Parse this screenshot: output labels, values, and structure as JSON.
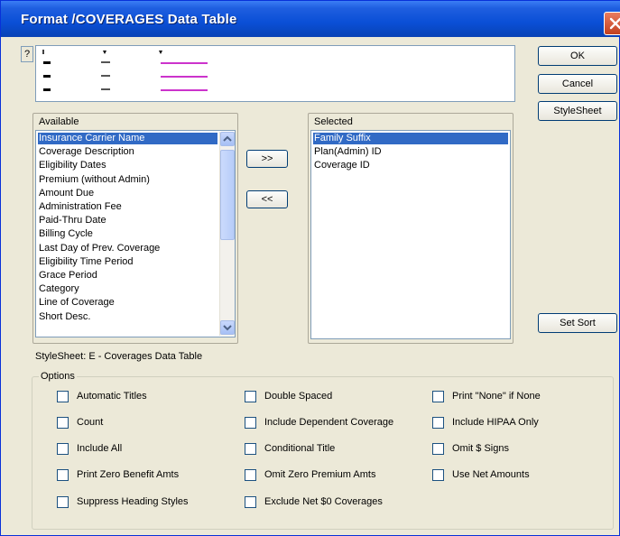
{
  "window": {
    "title": "Format  /COVERAGES  Data Table"
  },
  "buttons": {
    "help": "?",
    "ok": "OK",
    "cancel": "Cancel",
    "stylesheet": "StyleSheet",
    "add": ">>",
    "remove": "<<",
    "set_sort": "Set  Sort"
  },
  "available": {
    "label": "Available",
    "items": [
      "Insurance Carrier Name",
      "Coverage Description",
      "Eligibility Dates",
      "Premium (without Admin)",
      "Amount Due",
      "Administration Fee",
      "Paid-Thru Date",
      "Billing Cycle",
      "Last Day of Prev. Coverage",
      "Eligibility Time Period",
      "Grace Period",
      "Category",
      "Line of Coverage",
      "Short Desc."
    ],
    "selected_index": 0
  },
  "selected": {
    "label": "Selected",
    "items": [
      "Family Suffix",
      "Plan(Admin) ID",
      "Coverage ID"
    ],
    "selected_index": 0
  },
  "stylesheet_text": "StyleSheet: E - Coverages Data Table",
  "options": {
    "label": "Options",
    "col1": [
      "Automatic Titles",
      "Count",
      "Include All",
      "Print Zero Benefit Amts",
      "Suppress Heading Styles"
    ],
    "col2": [
      "Double Spaced",
      "Include Dependent Coverage",
      "Conditional Title",
      "Omit Zero Premium Amts",
      "Exclude Net $0 Coverages"
    ],
    "col3": [
      "Print \"None\" if None",
      "Include HIPAA Only",
      "Omit $ Signs",
      "Use Net Amounts"
    ]
  },
  "colors": {
    "titlebar": "#0a4fd6",
    "selection": "#316ac5",
    "preview_accent": "#cc33cc",
    "face": "#ece9d8"
  }
}
